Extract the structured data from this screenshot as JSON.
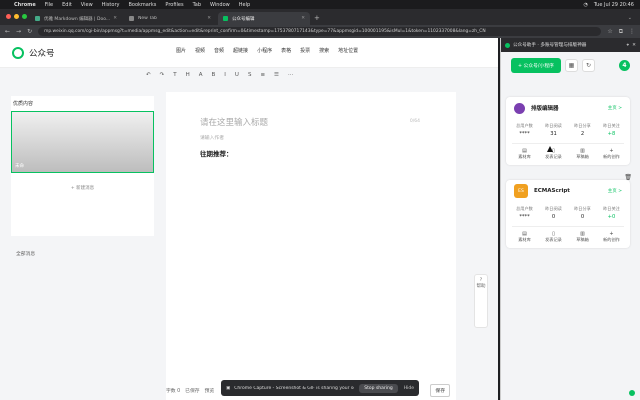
{
  "menubar": {
    "items": [
      "Chrome",
      "File",
      "Edit",
      "View",
      "History",
      "Bookmarks",
      "Profiles",
      "Tab",
      "Window",
      "Help"
    ],
    "datetime": "Tue Jul 29 20:46"
  },
  "tabs": [
    {
      "title": "优雅 Markdown 编辑器 | Doo...",
      "active": false
    },
    {
      "title": "New Tab",
      "active": false
    },
    {
      "title": "公众号编辑",
      "active": true
    }
  ],
  "address": {
    "url": "mp.weixin.qq.com/cgi-bin/appmsg?t=media/appmsg_edit&action=edit&reprint_confirm=0&timestamp=1753780717143&type=77&appmsgid=100001195&isMul=1&token=1102337008&lang=zh_CN"
  },
  "app": {
    "brand": "公众号",
    "toolbar_top": [
      "图片",
      "视频",
      "音频",
      "超链接",
      "小程序",
      "表格",
      "投票",
      "搜索",
      "地址位置"
    ],
    "toolbar_format": [
      "↶",
      "↷",
      "T",
      "H",
      "A",
      "B",
      "I",
      "U",
      "S",
      "≡",
      "☰",
      "⋯"
    ]
  },
  "article_list": {
    "header": "优质内容",
    "cover_caption": "未命",
    "add_label": "+ 新建消息",
    "all_articles": "全部消息"
  },
  "editor": {
    "title_placeholder": "请在这里输入标题",
    "count": "0/64",
    "author_placeholder": "请输入作者",
    "body_text": "往期推荐："
  },
  "side_helper": {
    "label": "帮助",
    "icon": "?"
  },
  "footer": {
    "word_count": "字数 0",
    "status": "已保存",
    "preview_label": "预览",
    "save_label": "保存"
  },
  "screen_share": {
    "message": "Chrome Capture - Screenshot & GIF is sharing your screen.",
    "stop_label": "Stop sharing",
    "hide_label": "Hide"
  },
  "side_panel": {
    "title": "公众号助手 · 多账号管理与排版神器",
    "add_button": "+ 公众号/小程序",
    "badge": "4",
    "accounts": [
      {
        "name": "排版编辑器",
        "avatar_color": "#7a3fb0",
        "link": "主页 >",
        "stats": [
          {
            "label": "总用户数",
            "value": "****"
          },
          {
            "label": "昨日阅读",
            "value": "31"
          },
          {
            "label": "昨日分享",
            "value": "2"
          },
          {
            "label": "昨日关注",
            "value": "+8"
          }
        ],
        "actions": [
          "素材库",
          "发表记录",
          "草稿箱",
          "新的创作"
        ]
      },
      {
        "name": "ECMAScript",
        "avatar_color": "#f0a020",
        "avatar_text": "ES",
        "link": "主页 >",
        "stats": [
          {
            "label": "总用户数",
            "value": "****"
          },
          {
            "label": "昨日阅读",
            "value": "0"
          },
          {
            "label": "昨日分享",
            "value": "0"
          },
          {
            "label": "昨日关注",
            "value": "+0"
          }
        ],
        "actions": [
          "素材库",
          "发表记录",
          "草稿箱",
          "新的创作"
        ]
      }
    ]
  }
}
